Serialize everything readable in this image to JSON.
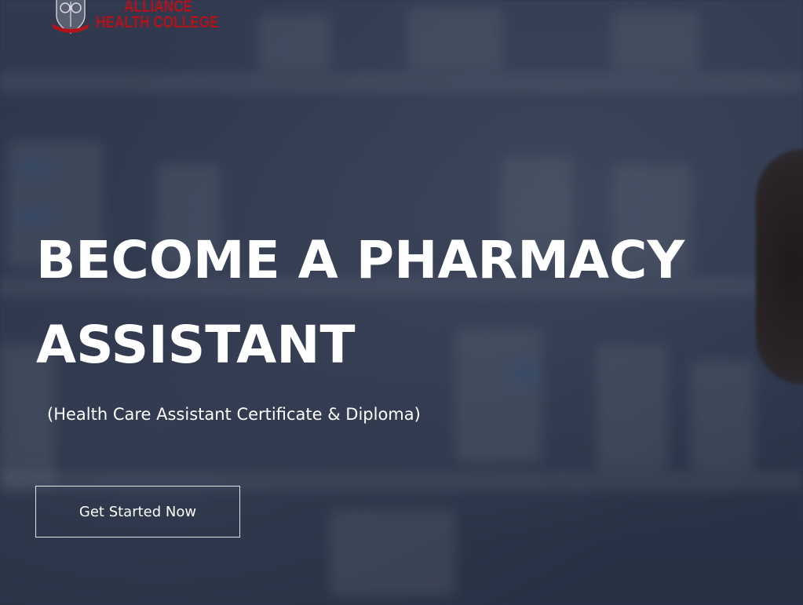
{
  "brand": {
    "name_line1": "ALLIANCE",
    "name_line2": "HEALTH COLLEGE",
    "color": "#b0131b",
    "crest_icon": "college-crest-icon"
  },
  "hero": {
    "headline": "BECOME A PHARMACY ASSISTANT",
    "subtitle": "(Health Care Assistant Certificate & Diploma)",
    "cta_label": "Get Started Now",
    "text_color": "#ffffff",
    "overlay_color": "#1e263a"
  }
}
